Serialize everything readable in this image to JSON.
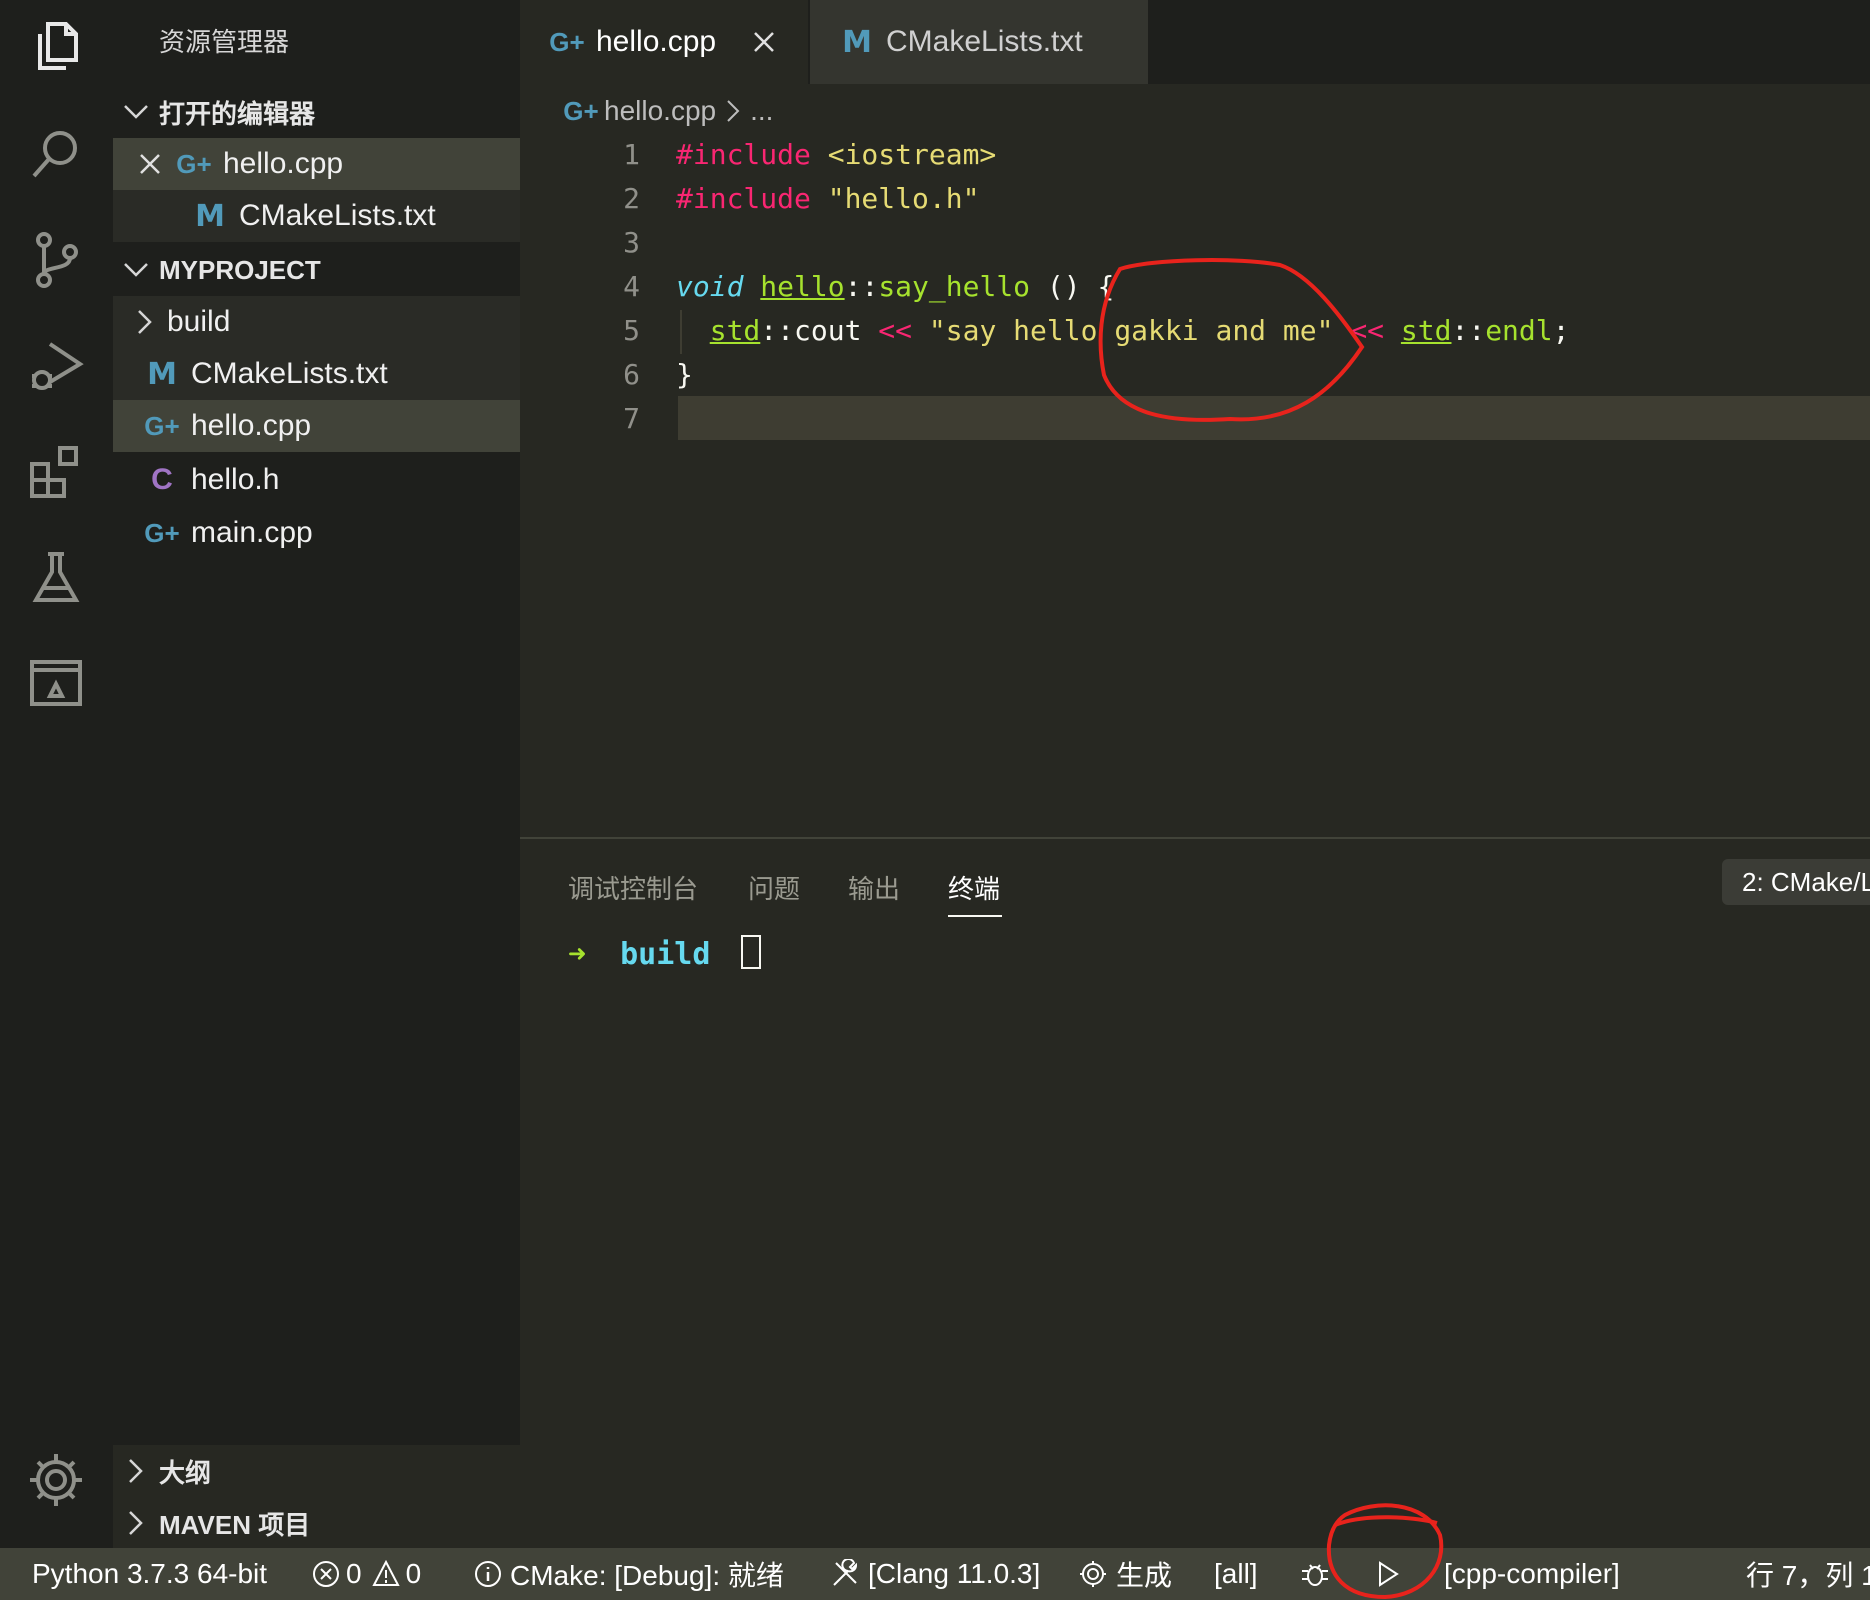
{
  "sidebar": {
    "title": "资源管理器",
    "open_editors": {
      "header": "打开的编辑器",
      "items": [
        {
          "name": "hello.cpp",
          "icon": "cpp-file-icon",
          "close": "×"
        },
        {
          "name": "CMakeLists.txt",
          "icon": "cmake-file-icon"
        }
      ]
    },
    "project": {
      "header": "MYPROJECT",
      "items": [
        {
          "name": "build",
          "type": "folder"
        },
        {
          "name": "CMakeLists.txt",
          "icon_letter": "M"
        },
        {
          "name": "hello.cpp",
          "icon_letter": "G+"
        },
        {
          "name": "hello.h",
          "icon_letter": "C"
        },
        {
          "name": "main.cpp",
          "icon_letter": "G+"
        }
      ]
    },
    "outline_header": "大纲",
    "maven_header": "MAVEN 项目"
  },
  "tabs": [
    {
      "label": "hello.cpp",
      "active": true
    },
    {
      "label": "CMakeLists.txt",
      "active": false
    }
  ],
  "breadcrumb": {
    "file": "hello.cpp",
    "rest": "..."
  },
  "editor": {
    "line_numbers": [
      "1",
      "2",
      "3",
      "4",
      "5",
      "6",
      "7"
    ],
    "lines": [
      {
        "n": 1,
        "tokens": [
          {
            "t": "#include",
            "c": "k-inc"
          },
          {
            "t": " <iostream>",
            "c": "k-str"
          }
        ]
      },
      {
        "n": 2,
        "tokens": [
          {
            "t": "#include",
            "c": "k-inc"
          },
          {
            "t": " \"hello.h\"",
            "c": "k-str"
          }
        ]
      },
      {
        "n": 3,
        "tokens": []
      },
      {
        "n": 4,
        "tokens": [
          {
            "t": "void",
            "c": "k-void"
          },
          {
            "t": " ",
            "c": "k-pl"
          },
          {
            "t": "hello",
            "c": "k-cls"
          },
          {
            "t": "::",
            "c": "k-pl"
          },
          {
            "t": "say_hello",
            "c": "k-fn"
          },
          {
            "t": " () {",
            "c": "k-pl"
          }
        ]
      },
      {
        "n": 5,
        "tokens": [
          {
            "t": "  ",
            "c": "k-pl"
          },
          {
            "t": "std",
            "c": "k-cls"
          },
          {
            "t": "::",
            "c": "k-pl"
          },
          {
            "t": "cout",
            "c": "k-pl"
          },
          {
            "t": " << ",
            "c": "k-op"
          },
          {
            "t": "\"say hello gakki and me\"",
            "c": "k-str"
          },
          {
            "t": " << ",
            "c": "k-op"
          },
          {
            "t": "std",
            "c": "k-cls"
          },
          {
            "t": "::",
            "c": "k-pl"
          },
          {
            "t": "endl",
            "c": "k-fn"
          },
          {
            "t": ";",
            "c": "k-pl"
          }
        ]
      },
      {
        "n": 6,
        "tokens": [
          {
            "t": "}",
            "c": "k-pl"
          }
        ]
      },
      {
        "n": 7,
        "tokens": []
      }
    ]
  },
  "panel": {
    "tabs": [
      "调试控制台",
      "问题",
      "输出",
      "终端"
    ],
    "active_tab": "终端",
    "terminal_selector": "2: CMake/L",
    "prompt_arrow": "➜",
    "prompt_dir": "build"
  },
  "statusbar": {
    "python": "Python 3.7.3 64-bit",
    "errors": "0",
    "warnings": "0",
    "cmake": "CMake: [Debug]: 就绪",
    "kit": "[Clang 11.0.3]",
    "build": "生成",
    "target": "[all]",
    "launch_target": "[cpp-compiler]",
    "position": "行 7，列 1"
  },
  "colors": {
    "background": "#272822",
    "sidebar": "#1e1f1c",
    "statusbar": "#414339",
    "annotation": "#e8231c"
  }
}
